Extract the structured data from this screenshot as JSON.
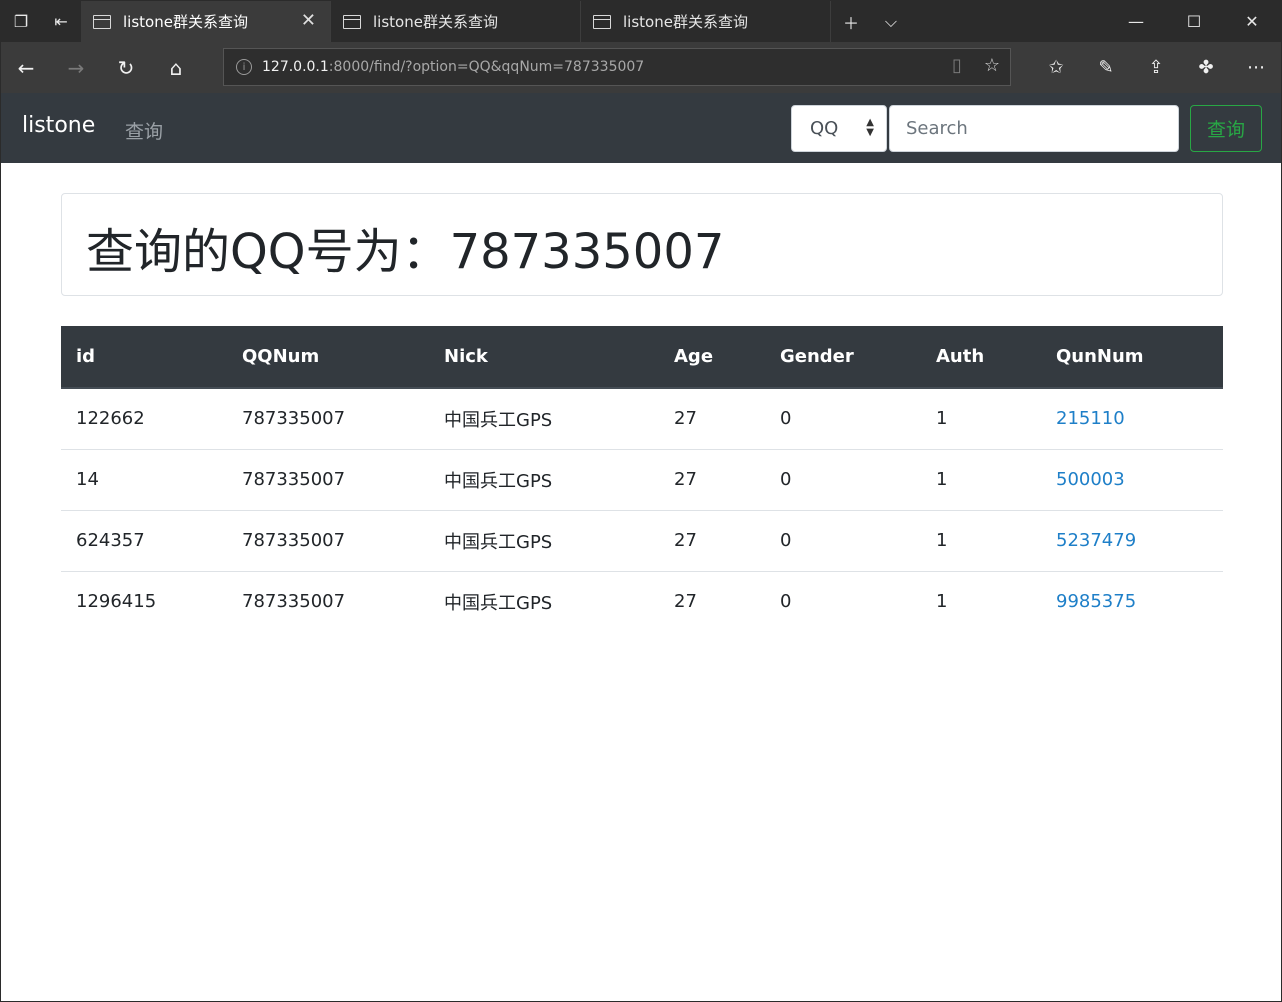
{
  "browser": {
    "tabs": [
      {
        "title": "listone群关系查询",
        "active": true
      },
      {
        "title": "listone群关系查询",
        "active": false
      },
      {
        "title": "listone群关系查询",
        "active": false
      }
    ],
    "url_host": "127.0.0.1",
    "url_rest": ":8000/find/?option=QQ&qqNum=787335007"
  },
  "navbar": {
    "brand": "listone",
    "link": "查询",
    "select_value": "QQ",
    "search_placeholder": "Search",
    "search_button": "查询"
  },
  "jumbotron": {
    "heading": "查询的QQ号为：787335007"
  },
  "table": {
    "headers": [
      "id",
      "QQNum",
      "Nick",
      "Age",
      "Gender",
      "Auth",
      "QunNum"
    ],
    "rows": [
      [
        "122662",
        "787335007",
        "中国兵工GPS",
        "27",
        "0",
        "1",
        "215110"
      ],
      [
        "14",
        "787335007",
        "中国兵工GPS",
        "27",
        "0",
        "1",
        "500003"
      ],
      [
        "624357",
        "787335007",
        "中国兵工GPS",
        "27",
        "0",
        "1",
        "5237479"
      ],
      [
        "1296415",
        "787335007",
        "中国兵工GPS",
        "27",
        "0",
        "1",
        "9985375"
      ]
    ]
  },
  "colors": {
    "navbar_bg": "#343a40",
    "success": "#28a745",
    "link": "#1e7fc8"
  }
}
